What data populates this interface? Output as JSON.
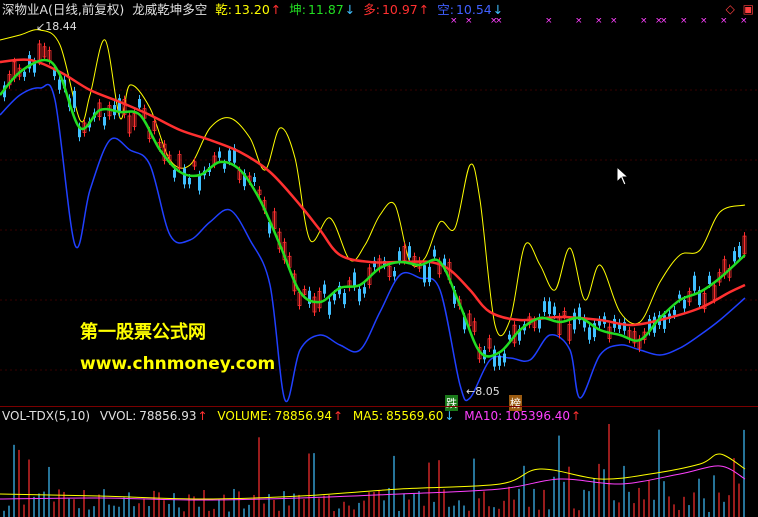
{
  "header": {
    "title": "深物业A(日线,前复权)",
    "indicator": "龙威乾坤多空",
    "qian_label": "乾:",
    "qian_value": "13.20",
    "qian_arrow": "↑",
    "kun_label": "坤:",
    "kun_value": "11.87",
    "kun_arrow": "↓",
    "duo_label": "多:",
    "duo_value": "10.97",
    "duo_arrow": "↑",
    "kong_label": "空:",
    "kong_value": "10.54",
    "kong_arrow": "↓"
  },
  "top_icons": [
    "◇",
    "▣"
  ],
  "colors": {
    "qian": "#ffff00",
    "kun": "#22dd22",
    "duo": "#ff3030",
    "kong": "#2040ff",
    "up": "#ff3030",
    "down": "#40c0ff",
    "magenta": "#ff40ff"
  },
  "annotations": {
    "high": "18.44",
    "low": "8.05",
    "tag_die": "跌",
    "tag_bang": "榜"
  },
  "watermark": {
    "line1": "第一股票公式网",
    "line2": "www.chnmoney.com"
  },
  "volume_header": {
    "indicator": "VOL-TDX(5,10)",
    "vvol_label": "VVOL:",
    "vvol_value": "78856.93",
    "vvol_arrow": "↑",
    "volume_label": "VOLUME:",
    "volume_value": "78856.94",
    "volume_arrow": "↑",
    "ma5_label": "MA5:",
    "ma5_value": "85569.60",
    "ma5_arrow": "↓",
    "ma10_label": "MA10:",
    "ma10_value": "105396.40",
    "ma10_arrow": "↑"
  }
}
